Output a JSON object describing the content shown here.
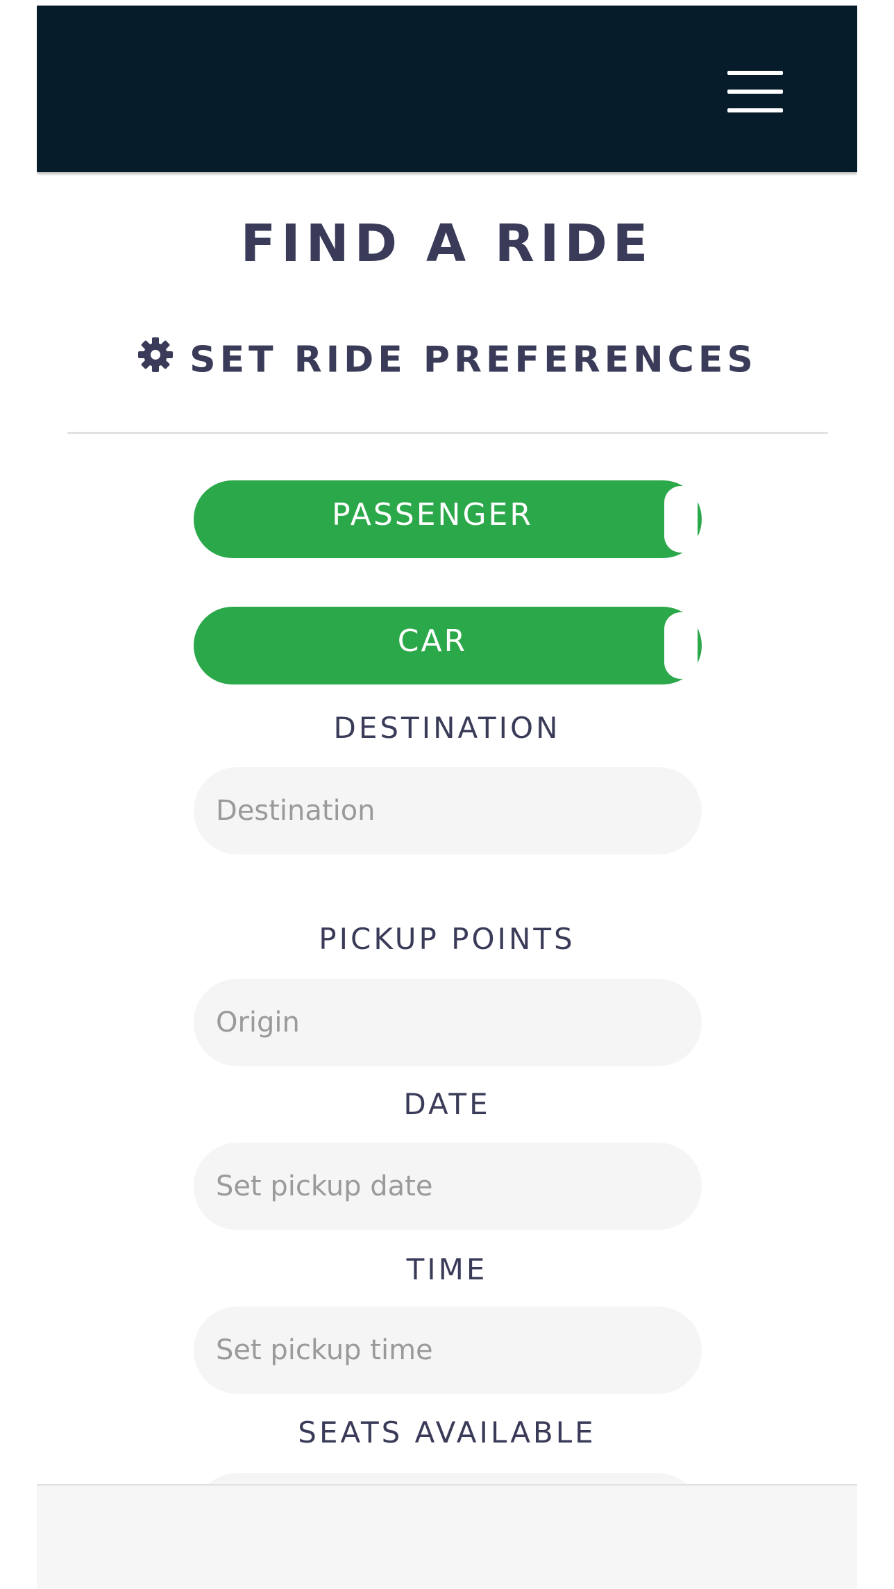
{
  "header": {
    "menu_icon": "hamburger-menu-icon",
    "background_color": "#071c2b"
  },
  "page": {
    "title": "FIND A RIDE",
    "preferences_heading": "SET RIDE PREFERENCES",
    "preferences_icon": "gear-icon"
  },
  "toggles": {
    "role": {
      "label": "PASSENGER",
      "on": true
    },
    "vehicle": {
      "label": "CAR",
      "on": true
    },
    "active_color": "#2ba84a"
  },
  "form": {
    "destination": {
      "label": "DESTINATION",
      "placeholder": "Destination",
      "value": ""
    },
    "pickup": {
      "label": "PICKUP POINTS",
      "placeholder": "Origin",
      "value": ""
    },
    "date": {
      "label": "DATE",
      "placeholder": "Set pickup date",
      "value": ""
    },
    "time": {
      "label": "TIME",
      "placeholder": "Set pickup time",
      "value": ""
    },
    "seats": {
      "label": "SEATS AVAILABLE",
      "placeholder": "",
      "value": ""
    }
  }
}
